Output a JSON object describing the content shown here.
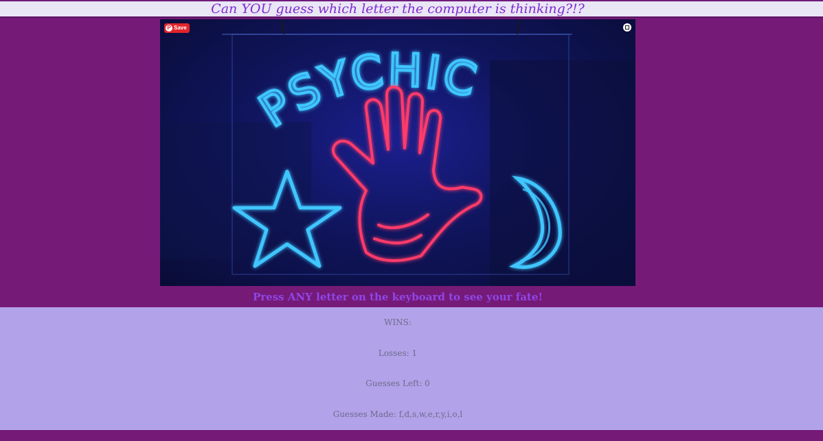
{
  "header": {
    "title": "Can YOU guess which letter the computer is thinking?!?"
  },
  "hero": {
    "sign_text": "PSYCHIC",
    "pin_label": "Save",
    "pin_logo": "P",
    "pin_icon": "pinterest-icon",
    "expand_icon": "expand-icon"
  },
  "instruction": "Press ANY letter on the keyboard to see your fate!",
  "stats": {
    "wins": "WINS:",
    "losses": "Losses: 1",
    "guesses_left": "Guesses Left: 0",
    "guesses_made": "Guesses Made: f,d,s,w,e,r,y,i,o,l"
  },
  "colors": {
    "page_bg": "#761a78",
    "header_bg": "#e9e6f6",
    "title": "#7f2ad0",
    "instruction": "#8d47e6",
    "stats_bg": "#b2a2e9",
    "neon_blue": "#3fc6ff",
    "neon_red": "#ff3b6a"
  }
}
